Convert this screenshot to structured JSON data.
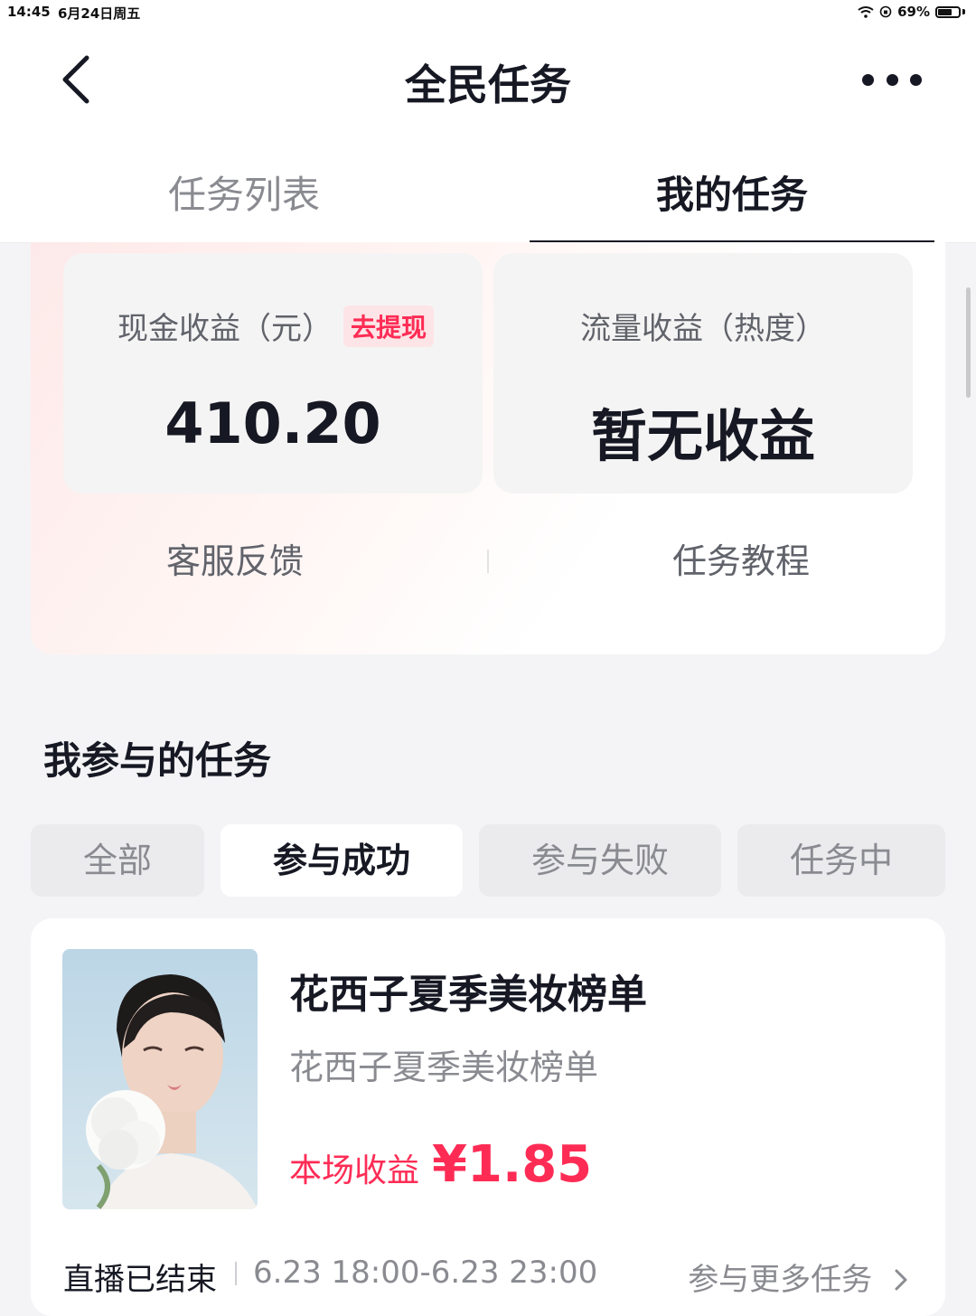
{
  "status_bar": {
    "time": "14:45",
    "date": "6月24日周五",
    "battery": "69%",
    "battery_level": 0.69
  },
  "nav": {
    "title": "全民任务"
  },
  "tabs": [
    {
      "label": "任务列表"
    },
    {
      "label": "我的任务"
    }
  ],
  "earnings": {
    "cash_label": "现金收益（元）",
    "withdraw_label": "去提现",
    "cash_value": "410.20",
    "traffic_label": "流量收益（热度）",
    "traffic_value": "暂无收益",
    "service_link": "客服反馈",
    "tutorial_link": "任务教程"
  },
  "section": {
    "title": "我参与的任务"
  },
  "filters": [
    {
      "label": "全部"
    },
    {
      "label": "参与成功",
      "selected": true
    },
    {
      "label": "参与失败"
    },
    {
      "label": "任务中"
    }
  ],
  "task": {
    "title": "花西子夏季美妆榜单",
    "subtitle": "花西子夏季美妆榜单",
    "earn_label": "本场收益",
    "earn_value": "¥1.85",
    "status": "直播已结束",
    "time_range": "6.23 18:00-6.23 23:00",
    "more_link": "参与更多任务"
  },
  "colors": {
    "accent": "#fe2c55",
    "text": "#161823",
    "muted": "#8a8b91"
  },
  "icons": {
    "back": "chevron-left-icon",
    "more": "more-dots-icon",
    "wifi": "wifi-icon",
    "chevron": "chevron-right-icon"
  }
}
